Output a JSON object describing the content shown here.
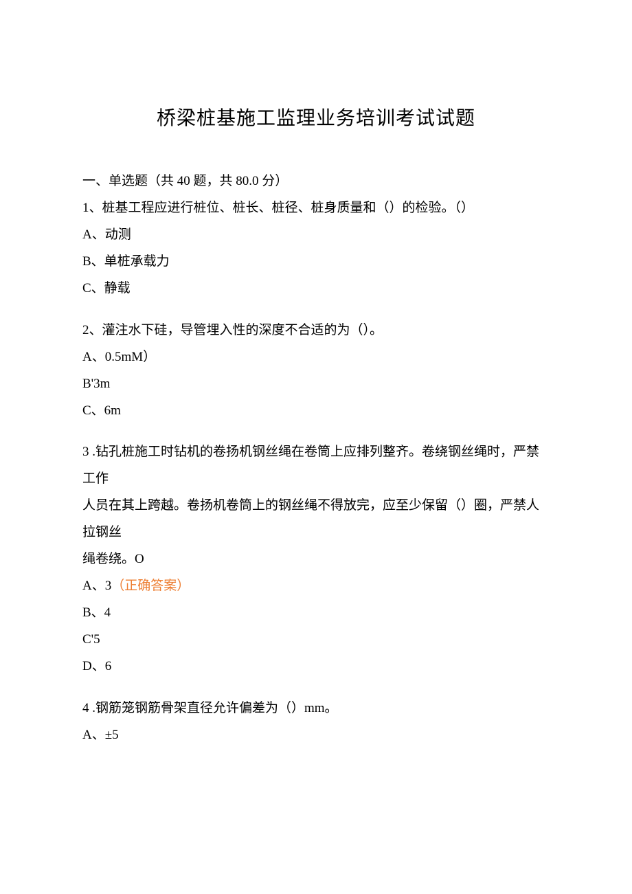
{
  "title": "桥梁桩基施工监理业务培训考试试题",
  "section": "一、单选题（共 40 题，共 80.0 分）",
  "q1": {
    "stem": "1、桩基工程应进行桩位、桩长、桩径、桩身质量和（）的检验。（）",
    "a": "A、动测",
    "b": "B、单桩承载力",
    "c": "C、静载"
  },
  "q2": {
    "stem": "2、灌注水下硅，导管埋入性的深度不合适的为（）。",
    "a": "A、0.5mM）",
    "b": "B'3m",
    "c": "C、6m"
  },
  "q3": {
    "stem1": "3 .钻孔桩施工时钻机的卷扬机钢丝绳在卷筒上应排列整齐。卷绕钢丝绳时，严禁工作",
    "stem2": "人员在其上跨越。卷扬机卷筒上的钢丝绳不得放完，应至少保留（）圈，严禁人拉钢丝",
    "stem3": "绳卷绕。O",
    "a_prefix": "A、3",
    "a_correct": "（正确答案）",
    "b": "B、4",
    "c": "C'5",
    "d": "D、6"
  },
  "q4": {
    "stem": "4 .钢筋笼钢筋骨架直径允许偏差为（）mm。",
    "a": "A、±5"
  }
}
